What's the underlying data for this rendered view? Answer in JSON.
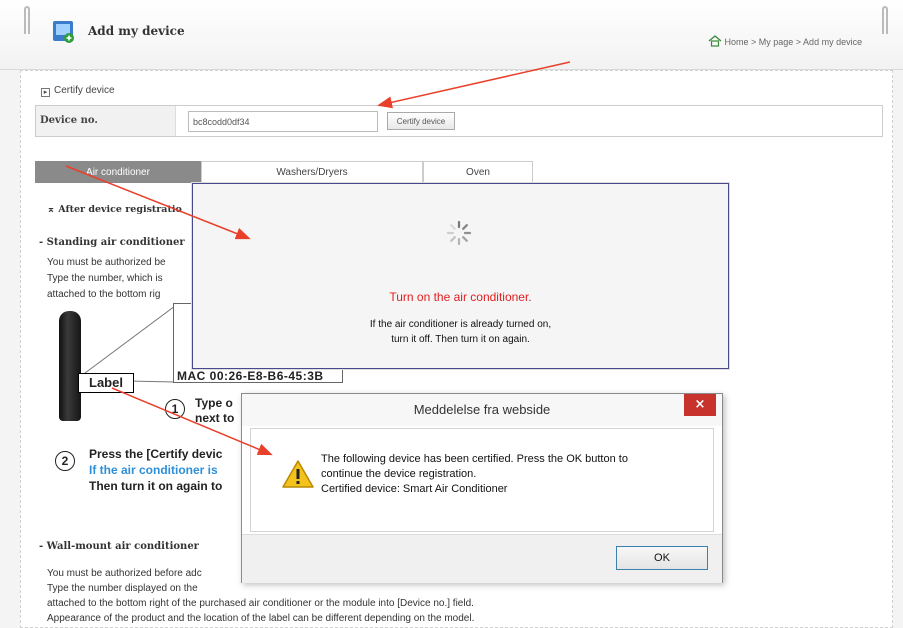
{
  "header": {
    "page_title": "Add my device",
    "breadcrumb": "Home > My page > Add my device"
  },
  "certify": {
    "section_label": "Certify device",
    "device_no_label": "Device no.",
    "device_no_value": "bc8codd0df34",
    "certify_button": "Certify device"
  },
  "tabs": [
    {
      "label": "Air conditioner",
      "active": true
    },
    {
      "label": "Washers/Dryers",
      "active": false
    },
    {
      "label": "Oven",
      "active": false
    }
  ],
  "content": {
    "after_registration": "After device registratio",
    "standing_heading": "- Standing air conditioner",
    "standing_lines": [
      "You must be authorized be",
      "Type the number, which is",
      "attached to the bottom rig"
    ],
    "label_text": "Label",
    "mac_text": "MAC 00:26-E8-B6-45:3B",
    "step1_lines": [
      "Type o",
      "next to"
    ],
    "step2_lines": [
      "Press the [Certify devic",
      "If the air conditioner is",
      "Then turn it on again to"
    ],
    "step_numbers": [
      "1",
      "2"
    ],
    "wall_heading": "- Wall-mount air conditioner",
    "wall_lines": [
      "You must be authorized before adc",
      "Type the number displayed on the",
      "attached to the bottom right of the purchased air conditioner or the module into [Device no.] field.",
      "Appearance of the product and the location of the label can be different depending on the model."
    ]
  },
  "loading_popup": {
    "title": "Turn on the air conditioner.",
    "line1": "If the air conditioner is already turned on,",
    "line2": "turn it off. Then turn it on again."
  },
  "dialog": {
    "title": "Meddelelse fra webside",
    "close_glyph": "×",
    "line1": "The following device has been certified. Press the OK button to",
    "line2": "continue the device registration.",
    "line3": " Certified device: Smart Air Conditioner",
    "ok_label": "OK"
  },
  "colors": {
    "arrow": "#e8402a",
    "accent_red": "#e02020",
    "tab_active": "#8a8a8a",
    "close_button": "#c7332c"
  }
}
